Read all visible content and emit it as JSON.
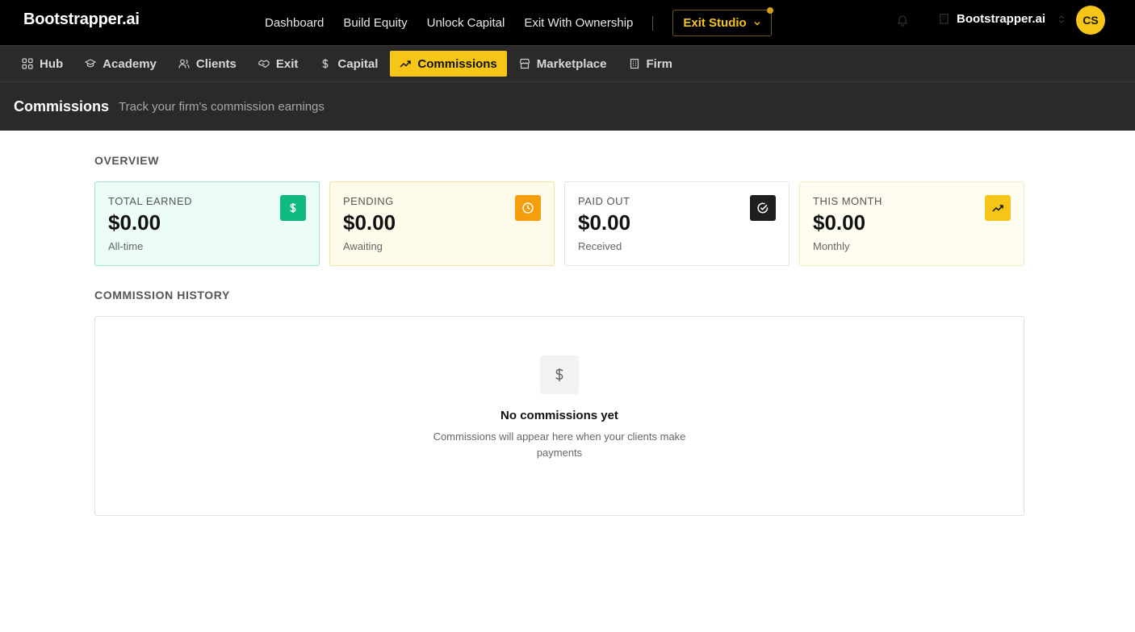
{
  "brand": "Bootstrapper.ai",
  "topnav": {
    "links": [
      "Dashboard",
      "Build Equity",
      "Unlock Capital",
      "Exit With Ownership"
    ],
    "studio_label": "Exit Studio"
  },
  "user": {
    "org_name": "Bootstrapper.ai",
    "initials": "CS"
  },
  "subnav": {
    "items": [
      {
        "label": "Hub",
        "icon": "grid-icon"
      },
      {
        "label": "Academy",
        "icon": "graduation-cap-icon"
      },
      {
        "label": "Clients",
        "icon": "users-icon"
      },
      {
        "label": "Exit",
        "icon": "handshake-icon"
      },
      {
        "label": "Capital",
        "icon": "dollar-icon"
      },
      {
        "label": "Commissions",
        "icon": "trending-up-icon",
        "active": true
      },
      {
        "label": "Marketplace",
        "icon": "store-icon"
      },
      {
        "label": "Firm",
        "icon": "building-icon"
      }
    ]
  },
  "page": {
    "title": "Commissions",
    "subtitle": "Track your firm's commission earnings"
  },
  "overview": {
    "label": "OVERVIEW",
    "cards": [
      {
        "label": "TOTAL EARNED",
        "value": "$0.00",
        "note": "All-time",
        "icon": "dollar-icon",
        "icon_bg": "#10b981"
      },
      {
        "label": "PENDING",
        "value": "$0.00",
        "note": "Awaiting",
        "icon": "clock-icon",
        "icon_bg": "#f59e0b"
      },
      {
        "label": "PAID OUT",
        "value": "$0.00",
        "note": "Received",
        "icon": "check-circle-icon",
        "icon_bg": "#1f1f1f"
      },
      {
        "label": "THIS MONTH",
        "value": "$0.00",
        "note": "Monthly",
        "icon": "trending-up-icon",
        "icon_bg": "#f5c518"
      }
    ]
  },
  "history": {
    "label": "COMMISSION HISTORY",
    "empty_title": "No commissions yet",
    "empty_desc": "Commissions will appear here when your clients make payments"
  },
  "colors": {
    "accent": "#f5c518",
    "topbar_bg": "#000000",
    "subnav_bg": "#2b2a28"
  }
}
